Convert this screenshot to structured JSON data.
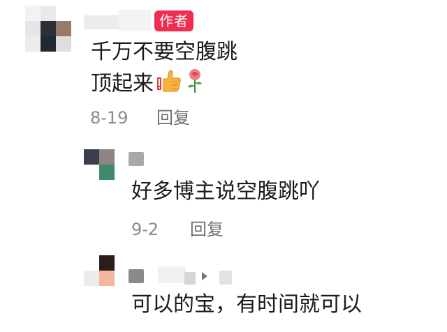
{
  "badge": {
    "author": "作者"
  },
  "comment1": {
    "line1": "千万不要空腹跳",
    "line2": "顶起来",
    "emojis": [
      "thumbs-up-icon",
      "rose-icon"
    ],
    "date": "8-19",
    "reply_label": "回复"
  },
  "reply1": {
    "text": "好多博主说空腹跳吖",
    "date": "9-2",
    "reply_label": "回复"
  },
  "reply2": {
    "text": "可以的宝，有时间就可以"
  },
  "colors": {
    "badge": "#f02d4f",
    "meta_text": "#8a8a8a",
    "body_text": "#1a1a1a"
  }
}
